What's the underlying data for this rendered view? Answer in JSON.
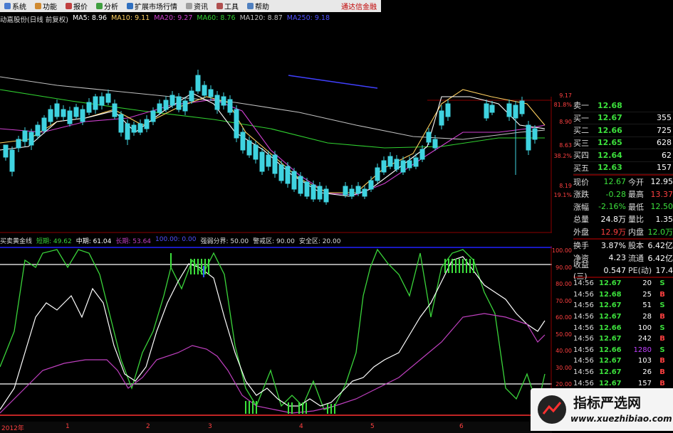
{
  "menu": {
    "items": [
      "系统",
      "功能",
      "报价",
      "分析",
      "扩展市场行情",
      "资讯",
      "工具",
      "帮助"
    ],
    "brand": "通达信金融"
  },
  "ma_line": {
    "stock": "动嘉股份(日线 前复权)",
    "ma5": "MA5: 8.96",
    "ma10": "MA10: 9.11",
    "ma20": "MA20: 9.27",
    "ma60": "MA60: 8.76",
    "ma120": "MA120: 8.87",
    "ma250": "MA250: 9.18"
  },
  "main_axis": {
    "labels": [
      "9.17",
      "81.8%",
      "8.90",
      "8.63",
      "38.2%",
      "8.19",
      "19.1%"
    ]
  },
  "indicator_line": {
    "name": "买卖黄金线",
    "short": "短期: 49.62",
    "mid": "中期: 61.04",
    "long": "长期: 53.64",
    "extra": "100.00: 0.00",
    "weak": "强弱分界: 50.00",
    "alert": "警戒区: 90.00",
    "safe": "安全区: 20.00"
  },
  "ind_axis": {
    "labels": [
      "100.00",
      "90.00",
      "80.00",
      "70.00",
      "60.00",
      "50.00",
      "40.00",
      "30.00",
      "20.00",
      "10.00"
    ]
  },
  "time_axis": {
    "labels": [
      "2012年",
      "1",
      "2",
      "3",
      "4",
      "5",
      "6"
    ]
  },
  "orderbook": [
    {
      "label": "卖一",
      "price": "12.68",
      "vol": ""
    },
    {
      "label": "买一",
      "price": "12.67",
      "vol": "355"
    },
    {
      "label": "买二",
      "price": "12.66",
      "vol": "725"
    },
    {
      "label": "买三",
      "price": "12.65",
      "vol": "628"
    },
    {
      "label": "买四",
      "price": "12.64",
      "vol": "62"
    },
    {
      "label": "买五",
      "price": "12.63",
      "vol": "157"
    }
  ],
  "stats": [
    {
      "k": "现价",
      "v": "12.67",
      "vc": "#3ce03c",
      "k2": "今开",
      "v2": "12.95",
      "v2c": "#fff"
    },
    {
      "k": "涨跌",
      "v": "-0.28",
      "vc": "#3ce03c",
      "k2": "最高",
      "v2": "13.37",
      "v2c": "#ff4040"
    },
    {
      "k": "涨幅",
      "v": "-2.16%",
      "vc": "#3ce03c",
      "k2": "最低",
      "v2": "12.50",
      "v2c": "#3ce03c"
    },
    {
      "k": "总量",
      "v": "24.8万",
      "vc": "#fff",
      "k2": "量比",
      "v2": "1.35",
      "v2c": "#fff"
    },
    {
      "k": "外盘",
      "v": "12.9万",
      "vc": "#ff4040",
      "k2": "内盘",
      "v2": "12.0万",
      "v2c": "#3ce03c"
    }
  ],
  "stats2": [
    {
      "k": "换手",
      "v": "3.87%",
      "vc": "#fff",
      "k2": "股本",
      "v2": "6.42亿",
      "v2c": "#fff"
    },
    {
      "k": "净资",
      "v": "4.23",
      "vc": "#fff",
      "k2": "流通",
      "v2": "6.42亿",
      "v2c": "#fff"
    },
    {
      "k": "收益(三)",
      "v": "0.547",
      "vc": "#fff",
      "k2": "PE(动)",
      "v2": "17.4",
      "v2c": "#fff"
    }
  ],
  "ticks": [
    {
      "t": "14:56",
      "p": "12.67",
      "q": "20",
      "s": "S"
    },
    {
      "t": "14:56",
      "p": "12.68",
      "q": "25",
      "s": "B"
    },
    {
      "t": "14:56",
      "p": "12.67",
      "q": "51",
      "s": "S"
    },
    {
      "t": "14:56",
      "p": "12.67",
      "q": "28",
      "s": "B"
    },
    {
      "t": "14:56",
      "p": "12.66",
      "q": "100",
      "s": "S"
    },
    {
      "t": "14:56",
      "p": "12.67",
      "q": "242",
      "s": "B"
    },
    {
      "t": "14:56",
      "p": "12.66",
      "q": "1280",
      "s": "S"
    },
    {
      "t": "14:56",
      "p": "12.67",
      "q": "103",
      "s": "B"
    },
    {
      "t": "14:56",
      "p": "12.67",
      "q": "26",
      "s": "B"
    },
    {
      "t": "14:56",
      "p": "12.67",
      "q": "157",
      "s": "B"
    }
  ],
  "watermark": {
    "title": "指标严选网",
    "url": "www.xuezhibiao.com"
  },
  "colors": {
    "up": "#ff3030",
    "down": "#3fd3e0",
    "ma5": "#ffffff",
    "ma10": "#ffd060",
    "ma20": "#d040d0",
    "ma60": "#30d030",
    "ma120": "#c0c0c0",
    "ma250": "#4040ff",
    "short": "#3ad43a",
    "mid": "#ffffff",
    "long": "#c040c0"
  }
}
